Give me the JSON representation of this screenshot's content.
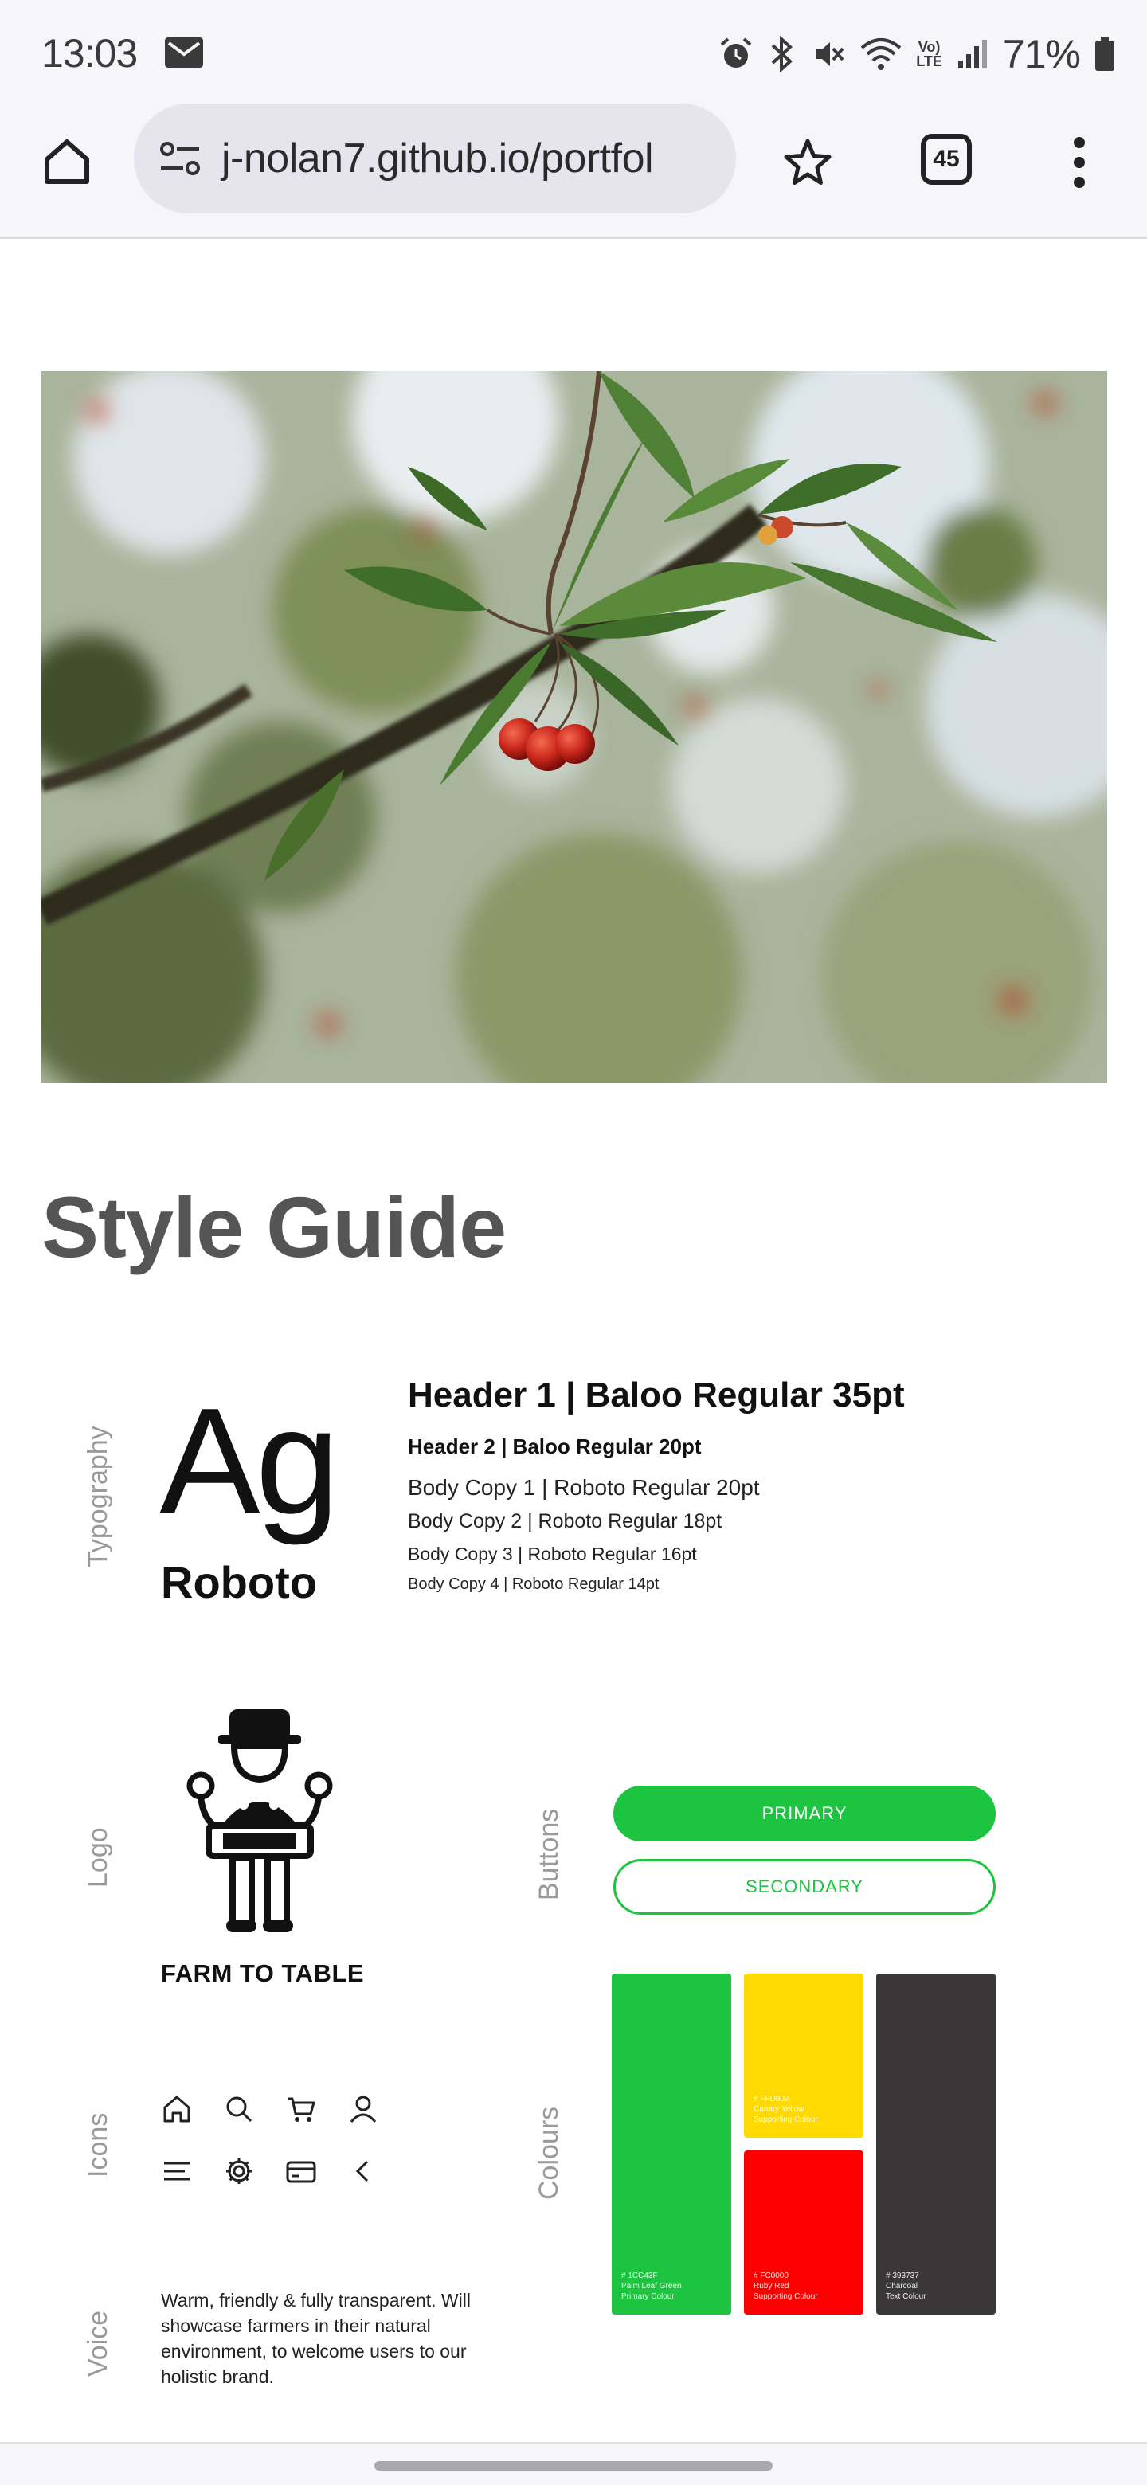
{
  "status_bar": {
    "time": "13:03",
    "battery": "71%",
    "icons": [
      "mail-icon",
      "alarm-icon",
      "bluetooth-icon",
      "mute-icon",
      "wifi-icon",
      "volte-icon",
      "signal-icon",
      "battery-icon"
    ],
    "volte_line1": "Vo)",
    "volte_line2": "LTE"
  },
  "browser": {
    "url": "j-nolan7.github.io/portfol",
    "tab_count": "45",
    "icons": [
      "home-icon",
      "site-info-icon",
      "star-icon",
      "tabs-icon",
      "more-menu-icon"
    ]
  },
  "page": {
    "title": "Style Guide",
    "hero_image": "cherry-tree-photo",
    "sections": {
      "typography": "Typography",
      "logo": "Logo",
      "buttons": "Buttons",
      "icons": "Icons",
      "colours": "Colours",
      "voice": "Voice"
    },
    "typography": {
      "sample": "Ag",
      "font_name": "Roboto",
      "styles": [
        "Header 1 | Baloo Regular 35pt",
        "Header 2 | Baloo Regular 20pt",
        "Body Copy 1 | Roboto Regular 20pt",
        "Body Copy 2 | Roboto Regular 18pt",
        "Body Copy 3 | Roboto Regular 16pt",
        "Body Copy 4 | Roboto Regular 14pt"
      ]
    },
    "logo": {
      "name": "FARM TO TABLE",
      "icon": "farmer-logo-icon"
    },
    "buttons": {
      "primary": "PRIMARY",
      "secondary": "SECONDARY"
    },
    "icon_set": [
      "home-icon",
      "search-icon",
      "cart-icon",
      "user-icon",
      "menu-icon",
      "gear-icon",
      "card-icon",
      "chevron-left-icon"
    ],
    "colours": [
      {
        "hex": "#1CC43F",
        "line1": "# 1CC43F",
        "line2": "Palm Leaf Green",
        "line3": "Primary Colour"
      },
      {
        "hex": "#FFD902",
        "line1": "# FFD902",
        "line2": "Canary Yellow",
        "line3": "Supporting Colour"
      },
      {
        "hex": "#FC0000",
        "line1": "# FC0000",
        "line2": "Ruby Red",
        "line3": "Supporting Colour"
      },
      {
        "hex": "#393737",
        "line1": "# 393737",
        "line2": "Charcoal",
        "line3": "Text Colour"
      }
    ],
    "voice": "Warm, friendly & fully transparent. Will showcase farmers in their natural environment, to welcome users to our holistic brand."
  }
}
